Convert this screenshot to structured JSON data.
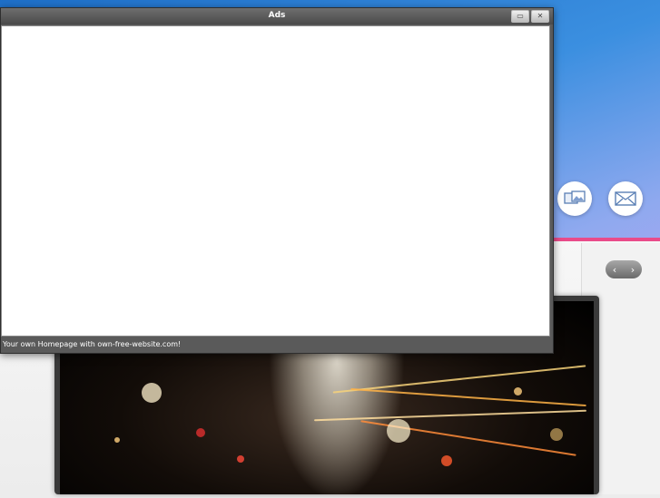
{
  "window": {
    "title": "Ads",
    "footer_text": "Your own Homepage with own-free-website.com!",
    "controls": [
      "maximize-icon",
      "close-icon"
    ]
  },
  "controls_labels": {
    "maximize": "▭",
    "close": "✕"
  },
  "side_buttons": [
    {
      "icon": "photo-gallery-icon"
    },
    {
      "icon": "mail-icon"
    }
  ],
  "nav_arrows": {
    "prev": "‹",
    "next": "›"
  },
  "colors": {
    "accent_stripe": "#e94b8a",
    "window_chrome": "#5a5a5a",
    "background_blue": "#1e6fc8"
  }
}
